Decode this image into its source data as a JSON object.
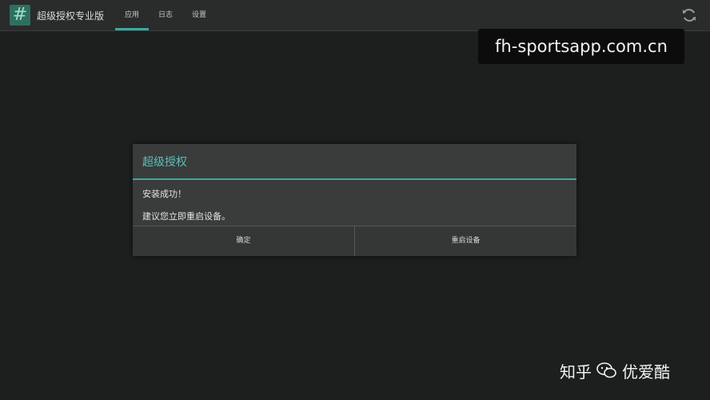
{
  "app": {
    "icon_glyph": "#",
    "title": "超级授权专业版",
    "tabs": [
      {
        "label": "应用",
        "active": true
      },
      {
        "label": "日志",
        "active": false
      },
      {
        "label": "设置",
        "active": false
      }
    ],
    "refresh_icon": "refresh-icon"
  },
  "watermark_top": "fh-sportsapp.com.cn",
  "dialog": {
    "title": "超级授权",
    "message_line1": "安装成功！",
    "message_line2": "建议您立即重启设备。",
    "buttons": {
      "ok": "确定",
      "reboot": "重启设备"
    }
  },
  "footer_watermark": {
    "left": "知乎",
    "right": "优爱酷"
  },
  "colors": {
    "accent": "#3aa9a0",
    "title_teal": "#5cc0b8",
    "background": "#1d1e1e"
  }
}
